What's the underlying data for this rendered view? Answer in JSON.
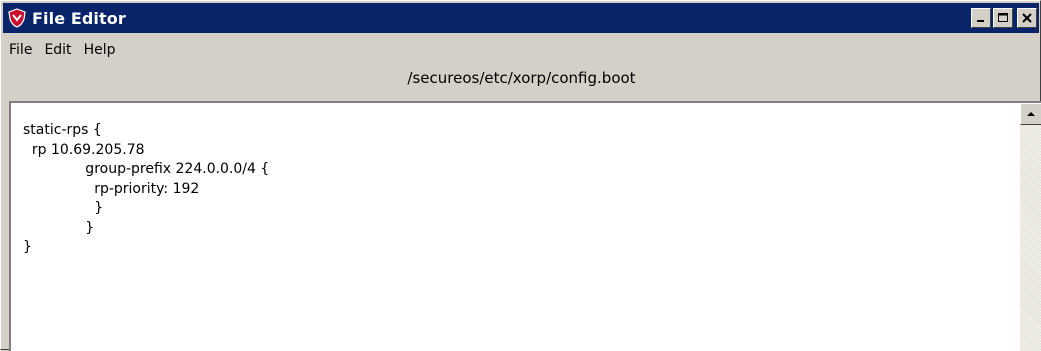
{
  "window": {
    "title": "File Editor",
    "icon": "shield-logo-icon"
  },
  "title_buttons": {
    "minimize_icon": "minimize-icon",
    "maximize_icon": "maximize-icon",
    "close_icon": "close-icon"
  },
  "menu": {
    "items": [
      {
        "label": "File"
      },
      {
        "label": "Edit"
      },
      {
        "label": "Help"
      }
    ]
  },
  "file": {
    "path": "/secureos/etc/xorp/config.boot"
  },
  "editor": {
    "lines": [
      "static-rps {",
      "  rp 10.69.205.78",
      "              group-prefix 224.0.0.0/4 {",
      "                rp-priority: 192",
      "                }",
      "              }",
      "}"
    ]
  },
  "scrollbar": {
    "up_icon": "scroll-up-arrow-icon"
  },
  "colors": {
    "titlebar": "#0a246a",
    "window_bg": "#d4d0c8",
    "editor_bg": "#ffffff",
    "icon_red": "#c8102e"
  }
}
